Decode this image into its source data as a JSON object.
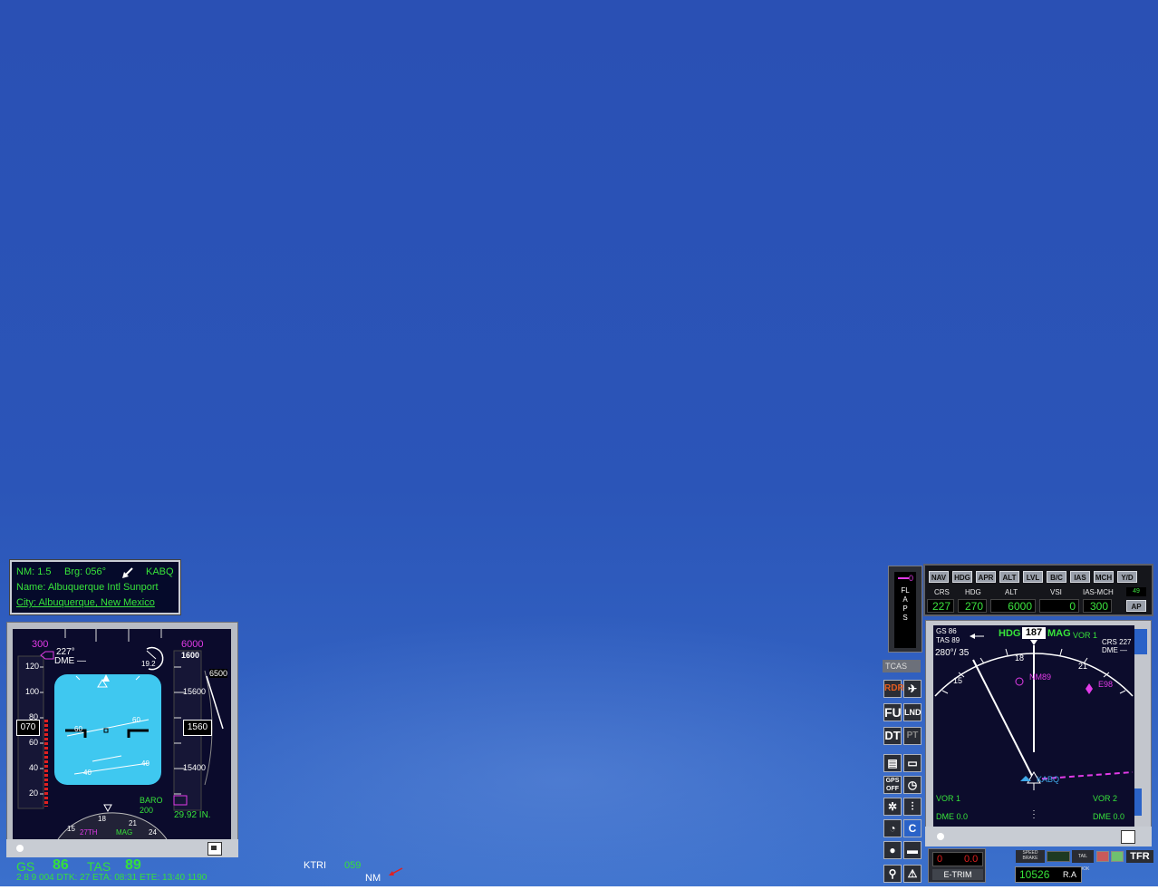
{
  "gps_info": {
    "nm": "NM: 1.5",
    "brg": "Brg: 056°",
    "ident": "KABQ",
    "name": "Name: Albuquerque Intl Sunport",
    "city": "City: Albuquerque, New Mexico"
  },
  "pfd": {
    "speed_bug": "300",
    "alt_bug": "6000",
    "course": "227°",
    "dme": "DME —",
    "dme_dist": "19.2",
    "speed_readout": "070",
    "alt_readout": "1560",
    "alt_tape": [
      "15600",
      "15400"
    ],
    "alt_tape_top": "1600",
    "vs_value": "6500",
    "speed_ticks": [
      "120",
      "100",
      "80",
      "60",
      "40",
      "20"
    ],
    "pitch_labels": [
      "60",
      "60",
      "40",
      "40"
    ],
    "baro_label": "BARO",
    "baro_value": "200",
    "baro_setting": "29.92 IN.",
    "heading_label": "27TH",
    "heading_mode": "MAG",
    "compass_ticks": [
      "15",
      "18",
      "21",
      "24"
    ]
  },
  "status_strip": {
    "gs_label": "GS",
    "gs_value": "86",
    "tas_label": "TAS",
    "tas_value": "89",
    "wp": "KTRI",
    "wp_dist": "059",
    "wp_unit": "NM",
    "row2": "2 8 9   004   DTK: 27   ETA: 08:31   ETE: 13:40   1190"
  },
  "autopilot": {
    "buttons": [
      "NAV",
      "HDG",
      "APR",
      "ALT",
      "LVL",
      "B/C",
      "IAS",
      "MCH",
      "Y/D"
    ],
    "indicator": "49",
    "labels": [
      "CRS",
      "HDG",
      "ALT",
      "VSI",
      "IAS-MCH"
    ],
    "values": [
      "227",
      "270",
      "6000",
      "0",
      "300"
    ],
    "ap_button": "AP"
  },
  "flaps": {
    "label": "FLAPS",
    "value": "0"
  },
  "side_panel": {
    "tcas": "TCAS",
    "rdr": "RDR",
    "fu": "FU",
    "lnd": "LND",
    "dt": "DT",
    "pt": "PT",
    "gps_off": "GPS OFF",
    "cc": "C"
  },
  "nd": {
    "gs": "GS  86",
    "tas": "TAS 89",
    "wind": "280°/ 35",
    "hdg_label": "HDG",
    "hdg_value": "187",
    "hdg_mode": "MAG",
    "vor1_top": "VOR 1",
    "crs": "CRS 227",
    "dme": "DME —",
    "compass": [
      "15",
      "18",
      "21"
    ],
    "waypoints": [
      "NM89",
      "E98"
    ],
    "station": "KABQ",
    "vor1": "VOR 1",
    "dme1": "DME 0.0",
    "vor2": "VOR 2",
    "dme2": "DME 0.0"
  },
  "bottom_right": {
    "trim_left": "0",
    "trim_right": "0.0",
    "trim_label": "E-TRIM",
    "speed_brake": "SPEED BRAKE",
    "tail_hook": "TAIL HOOK",
    "tfr": "TFR",
    "ra_value": "10526",
    "ra_label": "R.A"
  },
  "colors": {
    "sky": "#2b53b6",
    "green": "#37e33a",
    "magenta": "#e23be8",
    "attitude_sky": "#3fc8f0"
  }
}
